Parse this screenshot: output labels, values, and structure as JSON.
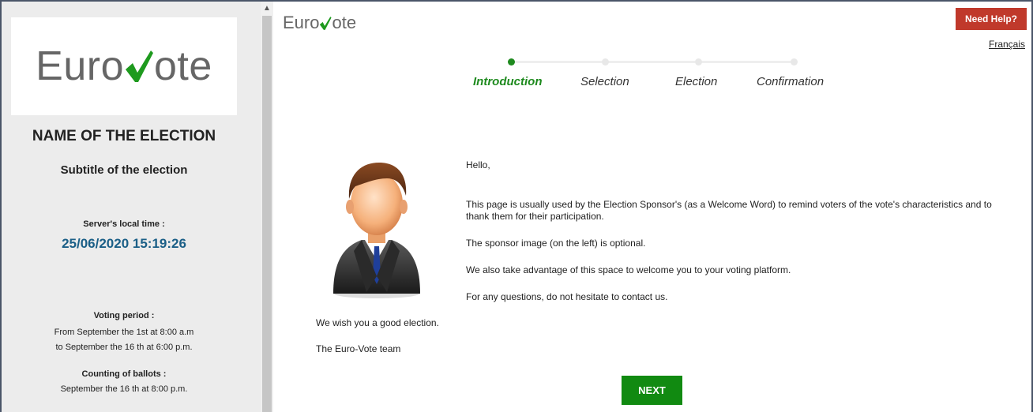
{
  "brand": {
    "logo_prefix": "Euro",
    "logo_suffix": "ote"
  },
  "sidebar": {
    "election_name": "NAME OF THE ELECTION",
    "election_subtitle": "Subtitle of the election",
    "server_time_label": "Server's local time :",
    "server_time_value": "25/06/2020 15:19:26",
    "voting_period_label": "Voting period :",
    "voting_period_from": "From September the 1st at 8:00 a.m",
    "voting_period_to": "to September the 16 th at 6:00 p.m.",
    "counting_label": "Counting of ballots :",
    "counting_value": "September the 16 th at 8:00 p.m."
  },
  "header": {
    "help_label": "Need Help?",
    "language_link": "Français"
  },
  "steps": [
    {
      "label": "Introduction",
      "active": true
    },
    {
      "label": "Selection",
      "active": false
    },
    {
      "label": "Election",
      "active": false
    },
    {
      "label": "Confirmation",
      "active": false
    }
  ],
  "content": {
    "greeting": "Hello,",
    "paragraph1": "This page is usually used by the Election Sponsor's (as a Welcome Word) to remind voters of the vote's characteristics and to thank them for their participation.",
    "paragraph2": "The sponsor image (on the left) is optional.",
    "paragraph3": "We also take advantage of this space to welcome you to your voting platform.",
    "paragraph4": "For any questions, do not hesitate to contact us.",
    "wish": "We wish you a good election.",
    "signature": "The Euro-Vote team"
  },
  "actions": {
    "next_label": "NEXT"
  },
  "colors": {
    "accent_green": "#1e8a1e",
    "help_red": "#c0392b",
    "time_blue": "#1b5f87"
  },
  "icons": {
    "scroll_up": "scroll-up-arrow-icon",
    "check": "checkmark-icon",
    "sponsor": "sponsor-avatar-icon"
  }
}
